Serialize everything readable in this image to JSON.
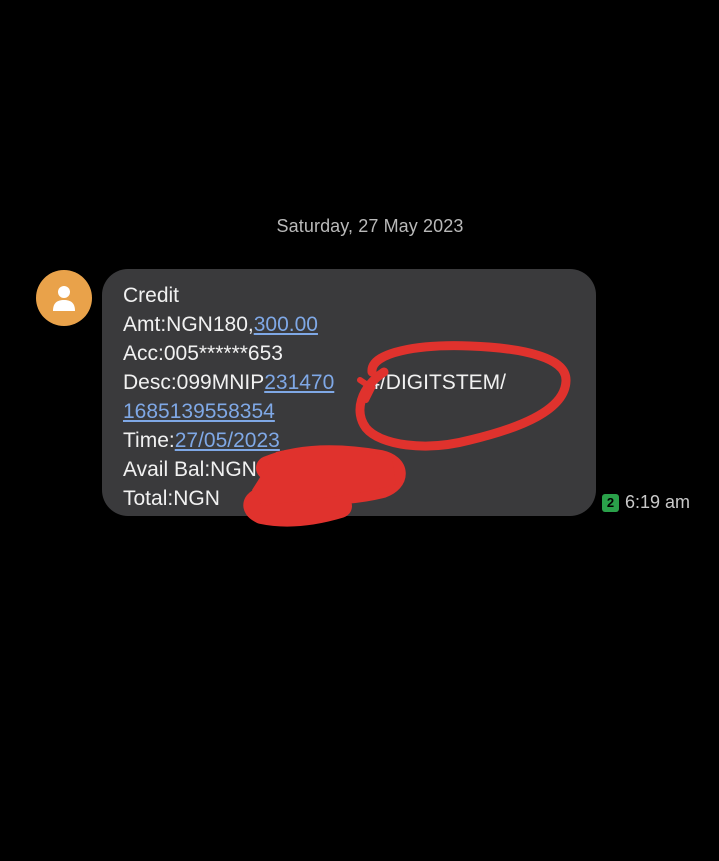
{
  "conversation": {
    "date_header": "Saturday, 27 May 2023"
  },
  "sender": {
    "avatar_icon": "person-icon",
    "avatar_color": "#e9a24a"
  },
  "message": {
    "title": "Credit",
    "amount_label": "Amt:NGN180,",
    "amount_link": "300.00",
    "account": "Acc:005******653",
    "desc_label": "Desc:099MNIP",
    "desc_link": "231470",
    "desc_suffix": "4/DIGITSTEM/",
    "desc_link_2": "1685139558354",
    "time_label": "Time:",
    "time_link": "27/05/2023",
    "avail_bal": "Avail Bal:NGN",
    "total": "Total:NGN"
  },
  "meta": {
    "sim_slot": "2",
    "timestamp": "6:19 am"
  },
  "colors": {
    "background": "#000000",
    "bubble": "#3a3a3c",
    "link": "#7fa8e6",
    "redaction": "#e0322d",
    "sim_badge": "#2aa14a"
  }
}
